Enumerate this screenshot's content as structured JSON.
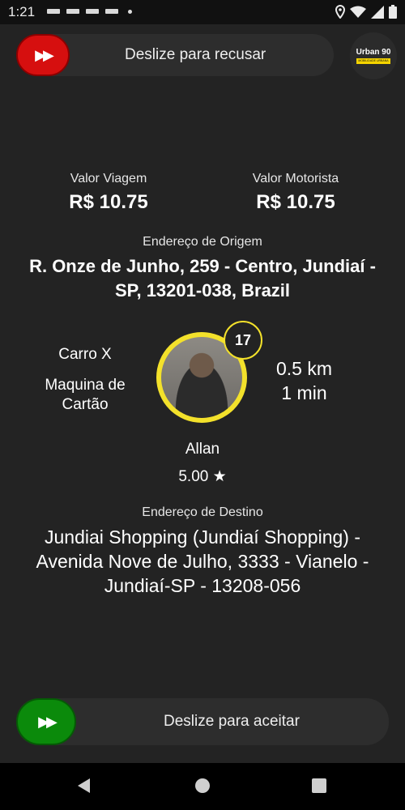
{
  "statusbar": {
    "time": "1:21"
  },
  "reject": {
    "label": "Deslize para recusar",
    "icon": "fast-forward-icon",
    "color": "#d60f0f"
  },
  "brand": {
    "name": "Urban 90",
    "tagline": "MOBILIDADE URBANA"
  },
  "fare": {
    "trip_label": "Valor Viagem",
    "trip_value": "R$ 10.75",
    "driver_label": "Valor Motorista",
    "driver_value": "R$ 10.75"
  },
  "origin": {
    "label": "Endereço de Origem",
    "address": "R. Onze de Junho, 259 - Centro, Jundiaí - SP, 13201-038, Brazil"
  },
  "ride": {
    "category": "Carro X",
    "payment": "Maquina de Cartão",
    "badge_count": "17",
    "distance": "0.5 km",
    "duration": "1 min"
  },
  "passenger": {
    "name": "Allan",
    "rating": "5.00 ★"
  },
  "destination": {
    "label": "Endereço de Destino",
    "address": "Jundiai Shopping (Jundiaí Shopping) - Avenida Nove de Julho, 3333 - Vianelo - Jundiaí-SP - 13208-056"
  },
  "accept": {
    "label": "Deslize para aceitar",
    "icon": "fast-forward-icon",
    "color": "#0b8a0b"
  },
  "accent": "#f3e12b"
}
